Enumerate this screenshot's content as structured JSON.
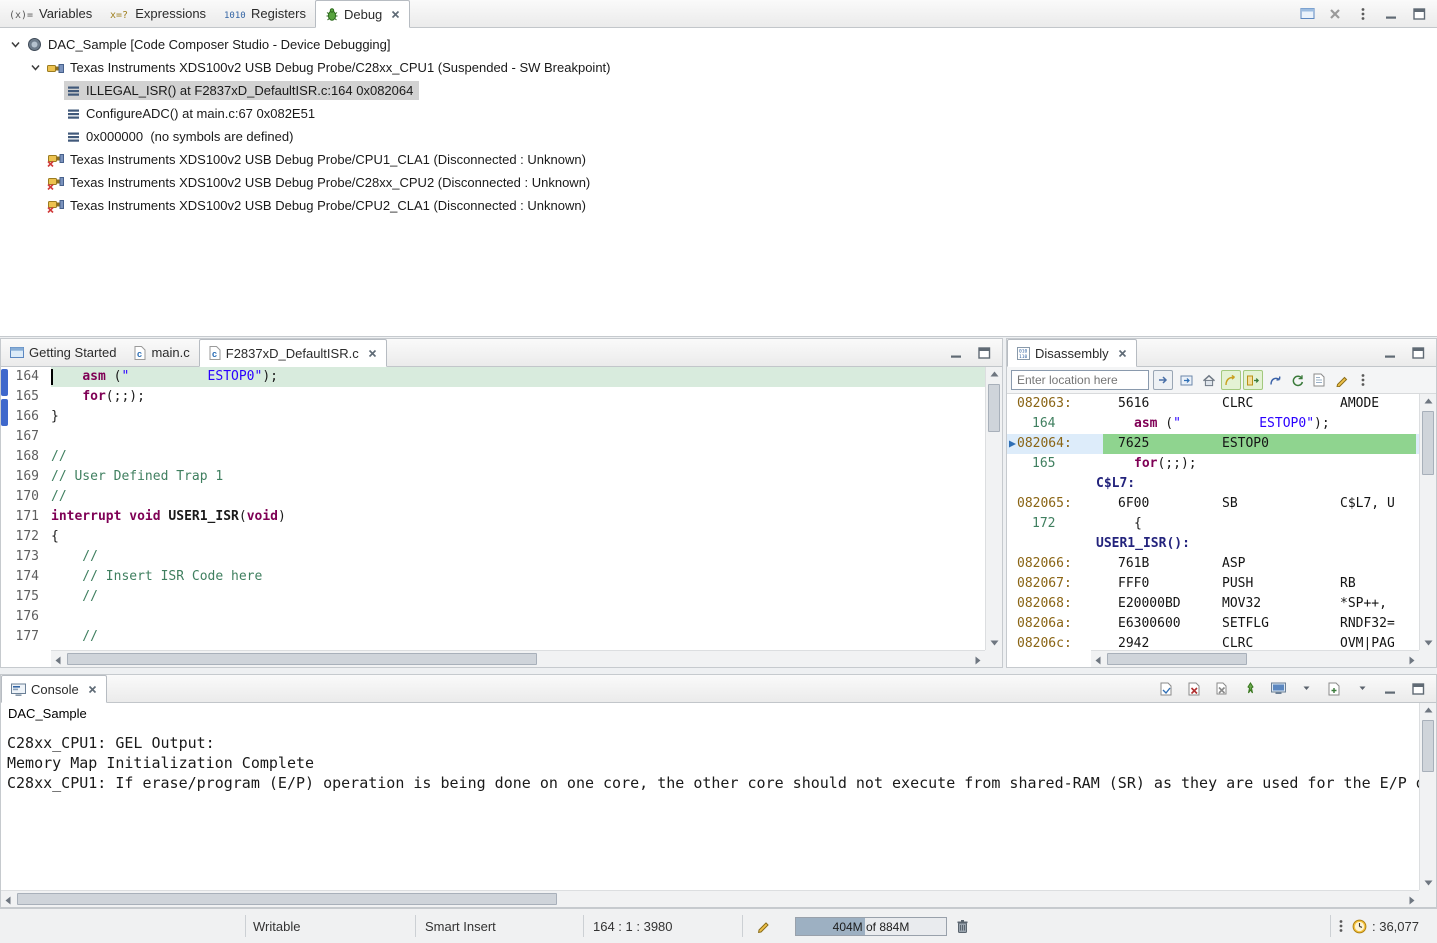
{
  "debug_panel": {
    "tabs": [
      {
        "label": "Variables",
        "icon": "variables-icon"
      },
      {
        "label": "Expressions",
        "icon": "expressions-icon"
      },
      {
        "label": "Registers",
        "icon": "registers-icon"
      },
      {
        "label": "Debug",
        "icon": "bug-icon",
        "active": true
      }
    ],
    "toolbar_icons": [
      "window-icon",
      "remove-all-icon",
      "view-menu-icon",
      "minimize-icon",
      "maximize-icon"
    ],
    "tree": [
      {
        "level": 0,
        "icon": "chip-icon",
        "expander": true,
        "label": "DAC_Sample [Code Composer Studio - Device Debugging]"
      },
      {
        "level": 1,
        "icon": "probe-icon",
        "expander": true,
        "label": "Texas Instruments XDS100v2 USB Debug Probe/C28xx_CPU1 (Suspended - SW Breakpoint)"
      },
      {
        "level": 2,
        "icon": "frame-icon",
        "selected": true,
        "label": "ILLEGAL_ISR() at F2837xD_DefaultISR.c:164 0x082064"
      },
      {
        "level": 2,
        "icon": "frame-icon",
        "label": "ConfigureADC() at main.c:67 0x082E51"
      },
      {
        "level": 2,
        "icon": "frame-icon",
        "label": "0x000000  (no symbols are defined)"
      },
      {
        "level": 1,
        "icon": "probe-x-icon",
        "label": "Texas Instruments XDS100v2 USB Debug Probe/CPU1_CLA1 (Disconnected : Unknown)"
      },
      {
        "level": 1,
        "icon": "probe-x-icon",
        "label": "Texas Instruments XDS100v2 USB Debug Probe/C28xx_CPU2 (Disconnected : Unknown)"
      },
      {
        "level": 1,
        "icon": "probe-x-icon",
        "label": "Texas Instruments XDS100v2 USB Debug Probe/CPU2_CLA1 (Disconnected : Unknown)"
      }
    ]
  },
  "editor": {
    "tabs": [
      {
        "label": "Getting Started",
        "icon": "home-tab-icon"
      },
      {
        "label": "main.c",
        "icon": "cfile-icon"
      },
      {
        "label": "F2837xD_DefaultISR.c",
        "icon": "cfile-icon",
        "active": true
      }
    ],
    "window_icons": [
      "minimize-icon",
      "maximize-icon"
    ],
    "lines": [
      {
        "num": "164",
        "current": true,
        "segs": [
          [
            "pl",
            "    "
          ],
          [
            "kw",
            "asm"
          ],
          [
            "pl",
            " ("
          ],
          [
            "str",
            "\"          ESTOP0\""
          ],
          [
            "pl",
            ");"
          ]
        ]
      },
      {
        "num": "165",
        "segs": [
          [
            "pl",
            "    "
          ],
          [
            "kw",
            "for"
          ],
          [
            "pl",
            "(;;);"
          ]
        ]
      },
      {
        "num": "166",
        "segs": [
          [
            "pl",
            "}"
          ]
        ]
      },
      {
        "num": "167",
        "segs": []
      },
      {
        "num": "168",
        "segs": [
          [
            "cm",
            "//"
          ]
        ]
      },
      {
        "num": "169",
        "segs": [
          [
            "cm",
            "// User Defined Trap 1"
          ]
        ]
      },
      {
        "num": "170",
        "segs": [
          [
            "cm",
            "//"
          ]
        ]
      },
      {
        "num": "171",
        "segs": [
          [
            "kw",
            "interrupt"
          ],
          [
            "pl",
            " "
          ],
          [
            "kw",
            "void"
          ],
          [
            "pl",
            " "
          ],
          [
            "fn",
            "USER1_ISR"
          ],
          [
            "pl",
            "("
          ],
          [
            "kw",
            "void"
          ],
          [
            "pl",
            ")"
          ]
        ]
      },
      {
        "num": "172",
        "segs": [
          [
            "pl",
            "{"
          ]
        ]
      },
      {
        "num": "173",
        "segs": [
          [
            "cm",
            "    //"
          ]
        ]
      },
      {
        "num": "174",
        "segs": [
          [
            "cm",
            "    // Insert ISR Code here"
          ]
        ]
      },
      {
        "num": "175",
        "segs": [
          [
            "cm",
            "    //"
          ]
        ]
      },
      {
        "num": "176",
        "segs": []
      },
      {
        "num": "177",
        "segs": [
          [
            "cm",
            "    //"
          ]
        ]
      }
    ]
  },
  "disassembly": {
    "tab_label": "Disassembly",
    "location_placeholder": "Enter location here",
    "toolbar_icons": [
      "navigate-icon",
      "home-icon",
      "link-with-source-icon",
      "link-with-frame-icon",
      "jump-to-pc-icon",
      "refresh-icon",
      "new-view-icon",
      "edit-icon",
      "view-menu-icon"
    ],
    "window_icons": [
      "minimize-icon",
      "maximize-icon"
    ],
    "rows": [
      {
        "type": "insn",
        "addr": "082063:",
        "opcode": "5616",
        "mn": "CLRC",
        "ops": "AMODE"
      },
      {
        "type": "src",
        "line": "164",
        "segs": [
          [
            "kw",
            "asm"
          ],
          [
            "pl",
            " ("
          ],
          [
            "str",
            "\"          ESTOP0\""
          ],
          [
            "pl",
            ");"
          ]
        ]
      },
      {
        "type": "insn",
        "addr": "082064:",
        "opcode": "7625",
        "mn": "ESTOP0",
        "ops": "",
        "current": true
      },
      {
        "type": "src",
        "line": "165",
        "segs": [
          [
            "kw",
            "for"
          ],
          [
            "pl",
            "(;;);"
          ]
        ]
      },
      {
        "type": "label",
        "text": "C$L7:"
      },
      {
        "type": "insn",
        "addr": "082065:",
        "opcode": "6F00",
        "mn": "SB",
        "ops": "C$L7, U"
      },
      {
        "type": "src",
        "line": "172",
        "segs": [
          [
            "pl",
            "{"
          ]
        ]
      },
      {
        "type": "label",
        "text": "USER1_ISR():"
      },
      {
        "type": "insn",
        "addr": "082066:",
        "opcode": "761B",
        "mn": "ASP",
        "ops": ""
      },
      {
        "type": "insn",
        "addr": "082067:",
        "opcode": "FFF0",
        "mn": "PUSH",
        "ops": "RB"
      },
      {
        "type": "insn",
        "addr": "082068:",
        "opcode": "E20000BD",
        "mn": "MOV32",
        "ops": "*SP++,"
      },
      {
        "type": "insn",
        "addr": "08206a:",
        "opcode": "E6300600",
        "mn": "SETFLG",
        "ops": "RNDF32="
      },
      {
        "type": "insn",
        "addr": "08206c:",
        "opcode": "2942",
        "mn": "CLRC",
        "ops": "OVM|PAG"
      }
    ]
  },
  "console": {
    "tab_label": "Console",
    "title": "DAC_Sample",
    "toolbar_icons": [
      "open-log-icon",
      "close-console-icon",
      "remove-all-consoles-icon",
      "pin-console-icon",
      "display-selected-console-icon",
      "dropdown-arrow-icon",
      "open-console-icon",
      "dropdown-arrow-icon",
      "minimize-icon",
      "maximize-icon"
    ],
    "lines": [
      "C28xx_CPU1: GEL Output:",
      "Memory Map Initialization Complete",
      "C28xx_CPU1: If erase/program (E/P) operation is being done on one core, the other core should not execute from shared-RAM (SR) as they are used for the E/P o"
    ]
  },
  "status_bar": {
    "writable": "Writable",
    "insert_mode": "Smart Insert",
    "position": "164 : 1 : 3980",
    "memory_label": "404M of 884M",
    "memory_percent": 46,
    "count": ": 36,077"
  }
}
